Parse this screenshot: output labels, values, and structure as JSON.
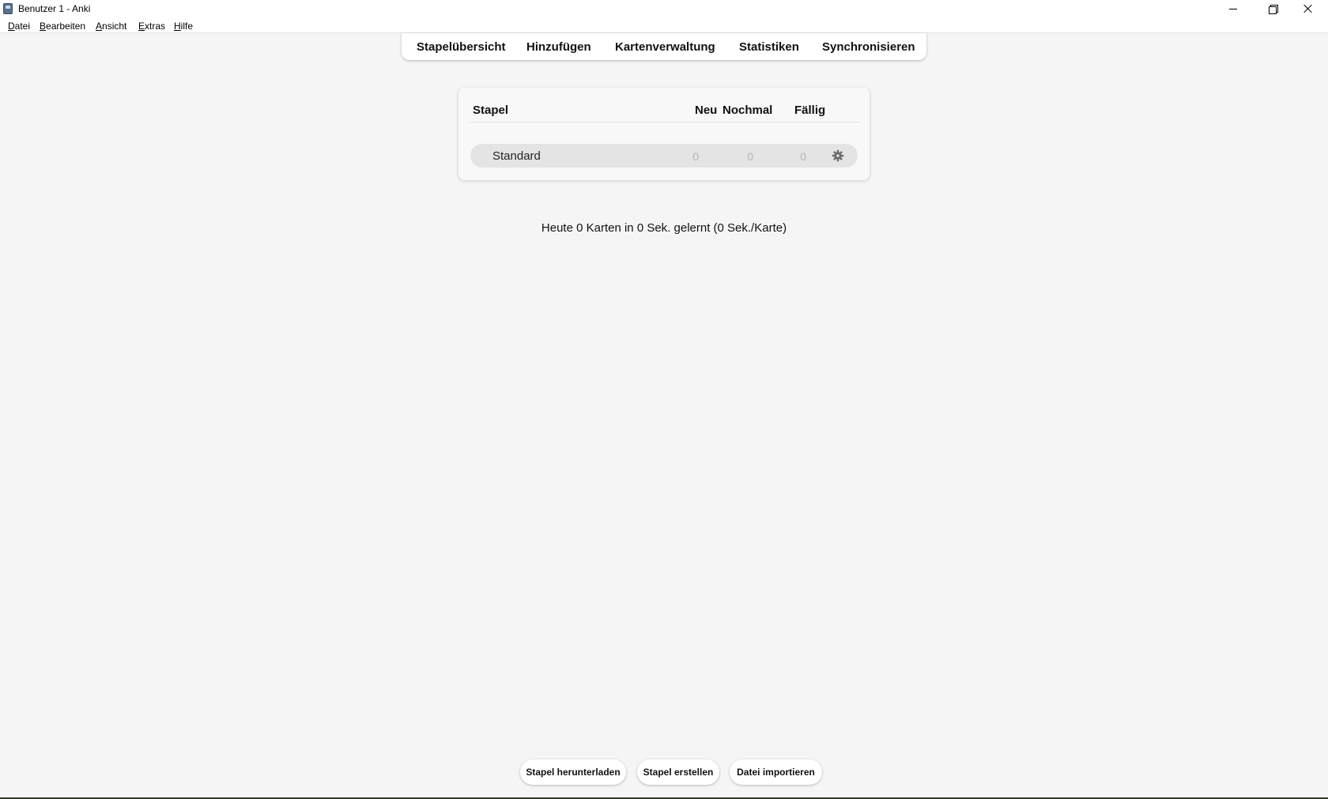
{
  "window": {
    "title": "Benutzer 1 - Anki",
    "icon": "anki-app-icon",
    "controls": [
      "minimize-icon",
      "restore-icon",
      "close-icon"
    ]
  },
  "menu": {
    "items": [
      {
        "label": "Datei"
      },
      {
        "label": "Bearbeiten"
      },
      {
        "label": "Ansicht"
      },
      {
        "label": "Extras"
      },
      {
        "label": "Hilfe"
      }
    ]
  },
  "toolbar": {
    "links": [
      {
        "label": "Stapelübersicht"
      },
      {
        "label": "Hinzufügen"
      },
      {
        "label": "Kartenverwaltung"
      },
      {
        "label": "Statistiken"
      },
      {
        "label": "Synchronisieren"
      }
    ]
  },
  "decks": {
    "headers": {
      "deck": "Stapel",
      "new": "Neu",
      "learn": "Nochmal",
      "due": "Fällig"
    },
    "rows": [
      {
        "name": "Standard",
        "new": "0",
        "learn": "0",
        "due": "0",
        "options_icon": "gear-icon"
      }
    ]
  },
  "stats": {
    "text": "Heute 0 Karten in 0 Sek. gelernt (0 Sek./Karte)"
  },
  "buttons": {
    "download": "Stapel herunterladen",
    "create": "Stapel erstellen",
    "import": "Datei importieren"
  },
  "colors": {
    "background": "#f5f5f5",
    "panel": "#f8f8f8",
    "deck_row": "#e4e4e4",
    "count_muted": "#b4b4b4"
  }
}
